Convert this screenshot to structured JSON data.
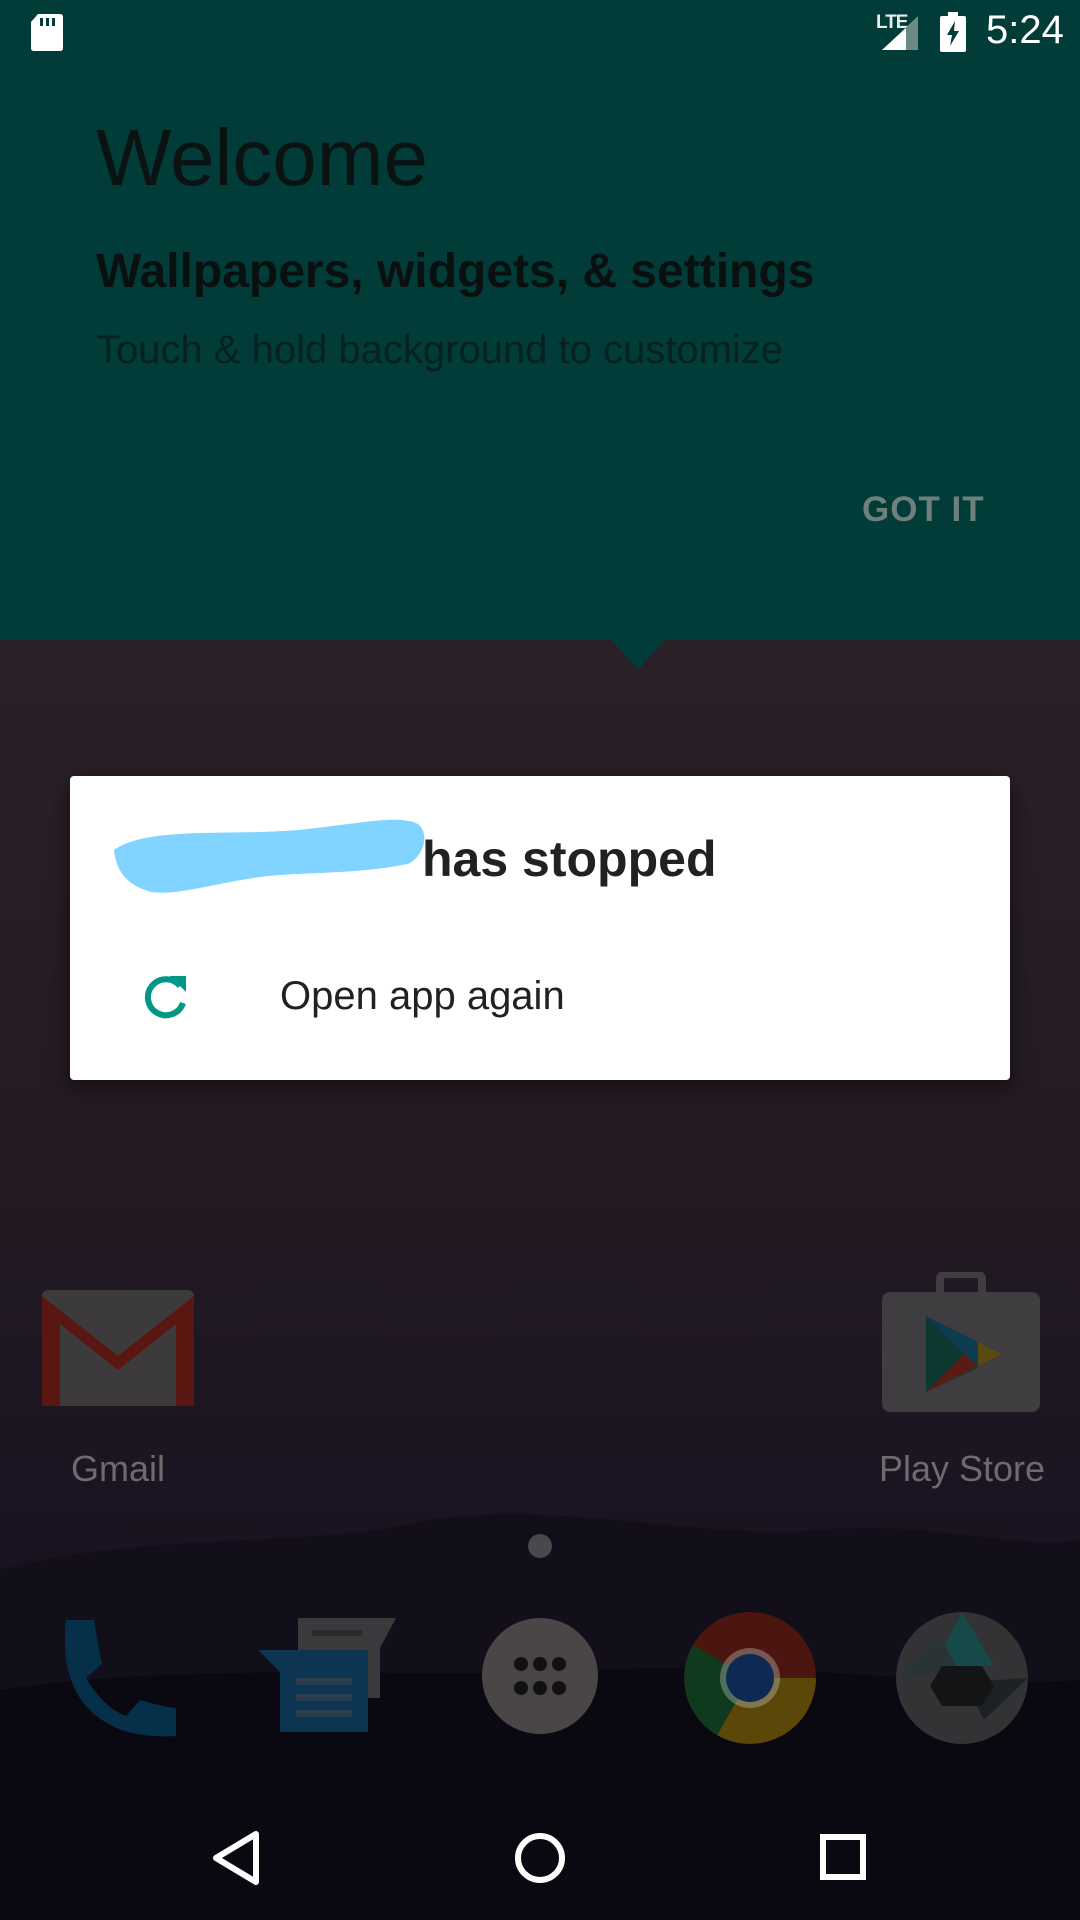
{
  "status_bar": {
    "network_label": "LTE",
    "time": "5:24",
    "icons": [
      "sd-card-icon",
      "signal-icon",
      "battery-charging-icon"
    ]
  },
  "welcome": {
    "title": "Welcome",
    "subtitle": "Wallpapers, widgets, & settings",
    "body": "Touch & hold background to customize",
    "button_label": "GOT IT",
    "background_color": "#023c38"
  },
  "dialog": {
    "title_suffix": "has stopped",
    "action_label": "Open app again",
    "action_icon": "refresh-icon",
    "accent_color": "#009688"
  },
  "home": {
    "apps": [
      {
        "label": "Gmail",
        "icon": "gmail-icon"
      },
      {
        "label": "Play Store",
        "icon": "play-store-icon"
      }
    ],
    "dock": [
      "phone-icon",
      "messages-icon",
      "app-drawer-icon",
      "chrome-icon",
      "camera-icon"
    ]
  },
  "nav_bar": [
    "back-icon",
    "home-icon",
    "recents-icon"
  ]
}
